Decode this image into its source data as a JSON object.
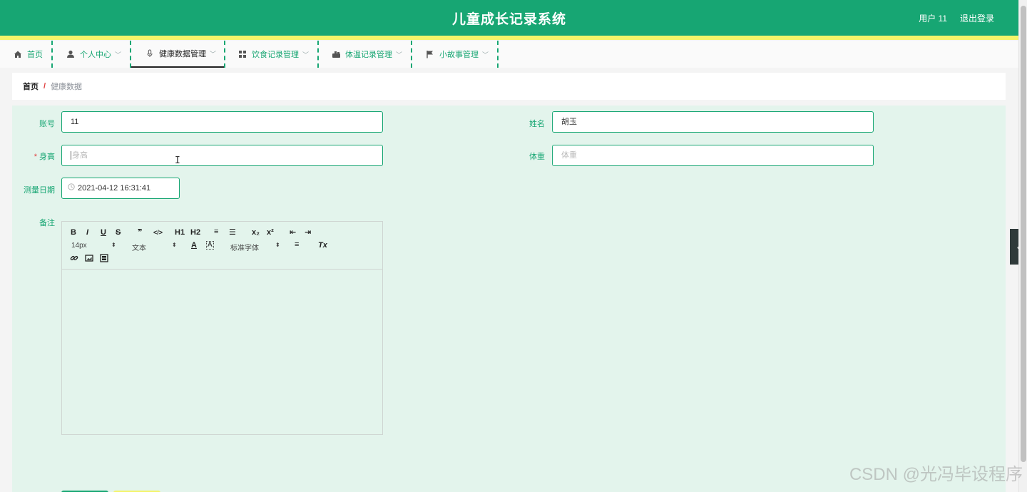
{
  "header": {
    "title": "儿童成长记录系统",
    "user": "用户 11",
    "logout": "退出登录"
  },
  "nav": {
    "items": [
      {
        "label": "首页",
        "icon": "home-icon",
        "has_dropdown": false
      },
      {
        "label": "个人中心",
        "icon": "user-icon",
        "has_dropdown": true
      },
      {
        "label": "健康数据管理",
        "icon": "microphone-icon",
        "has_dropdown": true,
        "active": true
      },
      {
        "label": "饮食记录管理",
        "icon": "grid-icon",
        "has_dropdown": true
      },
      {
        "label": "体温记录管理",
        "icon": "thermometer-icon",
        "has_dropdown": true
      },
      {
        "label": "小故事管理",
        "icon": "flag-icon",
        "has_dropdown": true
      }
    ]
  },
  "breadcrumb": {
    "home": "首页",
    "separator": "/",
    "current": "健康数据"
  },
  "form": {
    "account": {
      "label": "账号",
      "value": "11"
    },
    "name": {
      "label": "姓名",
      "value": "胡玉"
    },
    "height": {
      "label": "身高",
      "required_mark": "*",
      "placeholder": "身高"
    },
    "weight": {
      "label": "体重",
      "placeholder": "体重"
    },
    "date": {
      "label": "测量日期",
      "value": "2021-04-12 16:31:41"
    },
    "remark": {
      "label": "备注",
      "toolbar": {
        "bold": "B",
        "italic": "I",
        "underline": "U",
        "strike": "S",
        "quote": "❞",
        "code": "</>",
        "h1": "H1",
        "h2": "H2",
        "ordered_list": "≡",
        "bullet_list": "☰",
        "sub": "x₂",
        "sup": "x²",
        "outdent": "⇤",
        "indent": "⇥",
        "size": "14px",
        "header_select": "文本",
        "font_select": "标准字体",
        "color": "A",
        "background": "A",
        "align": "≡",
        "clean": "Tx"
      }
    }
  },
  "watermark": "CSDN @光冯毕设程序",
  "side_tab_icon": "chevron-left-icon",
  "colors": {
    "primary": "#17a673",
    "accent_yellow": "#f4f46a",
    "form_bg": "#e3f4ec"
  }
}
